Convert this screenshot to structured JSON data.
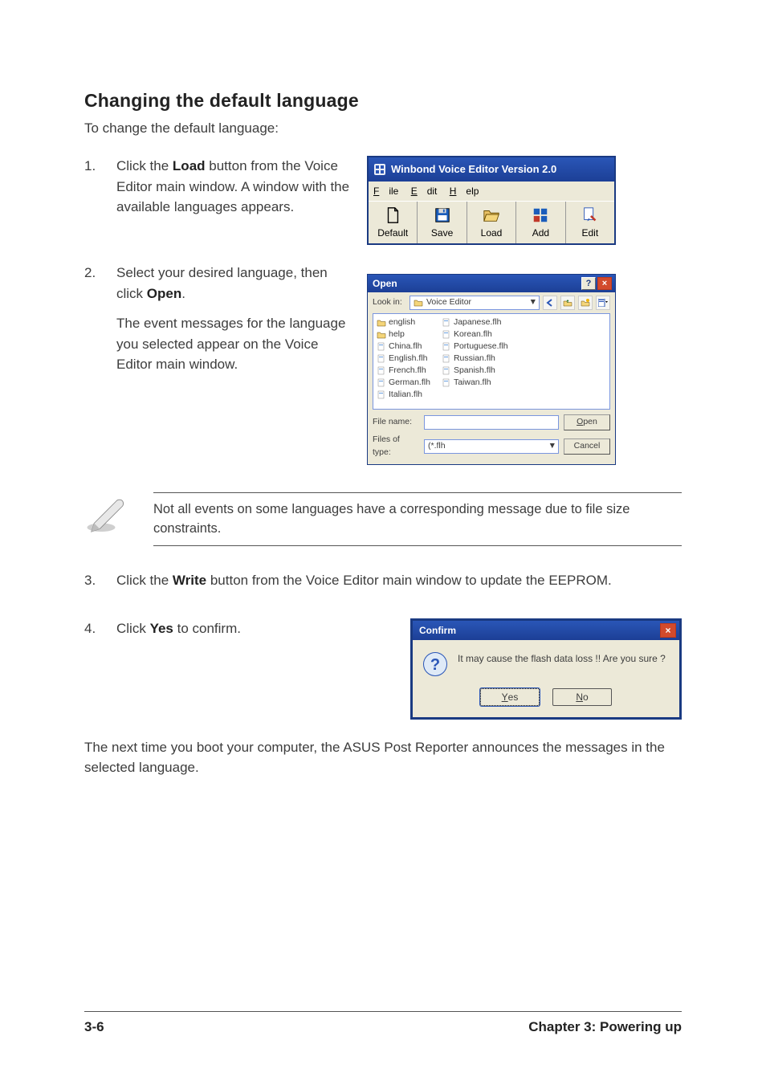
{
  "heading": "Changing the default language",
  "intro": "To change the default language:",
  "steps": {
    "one_num": "1.",
    "one_a": "Click the ",
    "one_load": "Load",
    "one_b": " button from the Voice Editor main window. A window with the available languages appears.",
    "two_num": "2.",
    "two_a": "Select your desired language, then click ",
    "two_open": "Open",
    "two_b": ".",
    "two_para2": "The event messages for the language you selected appear on the Voice Editor main window.",
    "three_num": "3.",
    "three_a": "Click the ",
    "three_write": "Write",
    "three_b": " button from the Voice Editor main window to update the EEPROM.",
    "four_num": "4.",
    "four_a": "Click ",
    "four_yes": "Yes",
    "four_b": " to confirm."
  },
  "winbond": {
    "title": "Winbond Voice Editor  Version 2.0",
    "menus": {
      "file": "File",
      "edit": "Edit",
      "help": "Help"
    },
    "buttons": {
      "default": "Default",
      "save": "Save",
      "load": "Load",
      "add": "Add",
      "edit": "Edit"
    }
  },
  "open_dialog": {
    "title": "Open",
    "look_in_label": "Look in:",
    "look_in_value": "Voice Editor",
    "files": [
      "english",
      "help",
      "China.flh",
      "English.flh",
      "French.flh",
      "German.flh",
      "Italian.flh",
      "Japanese.flh",
      "Korean.flh",
      "Portuguese.flh",
      "Russian.flh",
      "Spanish.flh",
      "Taiwan.flh"
    ],
    "file_name_label": "File name:",
    "file_name_value": "",
    "files_of_type_label": "Files of type:",
    "files_of_type_value": "(*.flh",
    "open_btn": "Open",
    "cancel_btn": "Cancel"
  },
  "note": "Not all events on some languages have a corresponding message due to file size constraints.",
  "confirm": {
    "title": "Confirm",
    "message": "It may cause the flash data loss !!  Are you sure ?",
    "yes": "Yes",
    "no": "No"
  },
  "closing": "The next time you boot your computer, the ASUS Post Reporter announces the messages in the selected language.",
  "footer": {
    "left": "3-6",
    "right": "Chapter 3: Powering up"
  }
}
